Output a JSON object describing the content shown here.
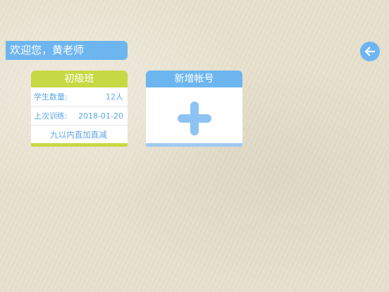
{
  "header": {
    "welcome_text": "欢迎您，黄老师"
  },
  "class_card": {
    "title": "初级班",
    "student_count_label": "学生数量:",
    "student_count_value": "12人",
    "last_training_label": "上次训练:",
    "last_training_value": "2018-01-20",
    "course_name": "九以内直加直减"
  },
  "add_card": {
    "title": "新增帐号"
  },
  "icons": {
    "back": "arrow-left-icon",
    "add": "plus-icon"
  },
  "colors": {
    "accent_blue": "#6db5ef",
    "accent_green": "#c6d944",
    "text_blue": "#5ba6e8"
  }
}
